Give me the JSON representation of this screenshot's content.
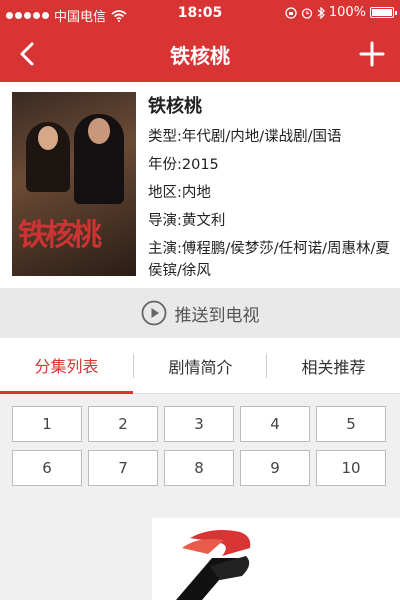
{
  "status_bar": {
    "carrier": "中国电信",
    "time": "18:05",
    "battery": "100%",
    "battery_level": 1.0
  },
  "nav": {
    "title": "铁核桃"
  },
  "show": {
    "title": "铁核桃",
    "type": "类型:年代剧/内地/谍战剧/国语",
    "year": "年份:2015",
    "region": "地区:内地",
    "director": "导演:黄文利",
    "cast": "主演:傅程鹏/侯梦莎/任柯诺/周惠林/夏侯镔/徐风",
    "poster_title": "铁核桃"
  },
  "push": {
    "label": "推送到电视"
  },
  "tabs": [
    "分集列表",
    "剧情简介",
    "相关推荐"
  ],
  "active_tab": 0,
  "episodes": [
    "1",
    "2",
    "3",
    "4",
    "5",
    "6",
    "7",
    "8",
    "9",
    "10"
  ],
  "colors": {
    "accent": "#d83434"
  }
}
